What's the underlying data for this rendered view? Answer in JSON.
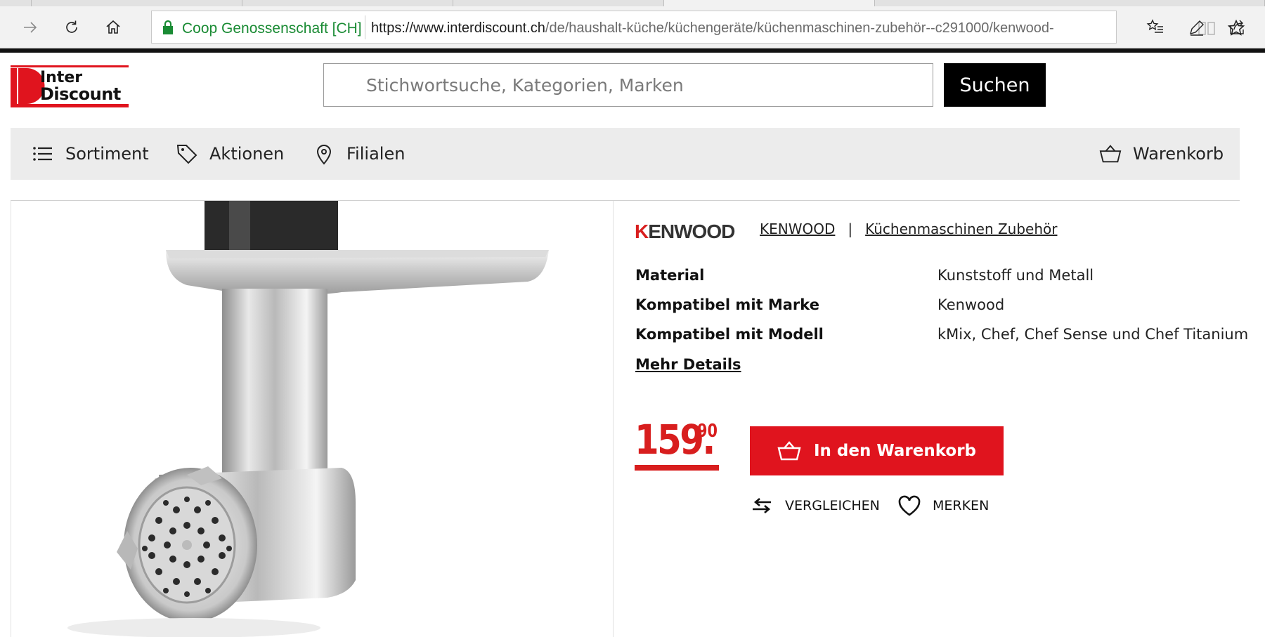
{
  "browser": {
    "site_identity": "Coop Genossenschaft [CH]",
    "url_host": "https://www.interdiscount.ch",
    "url_path": "/de/haushalt-küche/küchengeräte/küchenmaschinen-zubehör--c291000/kenwood-"
  },
  "header": {
    "logo_line1": "Inter",
    "logo_line2": "Discount",
    "search_placeholder": "Stichwortsuche, Kategorien, Marken",
    "search_button": "Suchen"
  },
  "nav": {
    "sortiment": "Sortiment",
    "aktionen": "Aktionen",
    "filialen": "Filialen",
    "warenkorb": "Warenkorb"
  },
  "product": {
    "brand_logo_k": "K",
    "brand_logo_rest": "ENWOOD",
    "brand_link": "KENWOOD",
    "crumb_separator": "|",
    "category_link": "Küchenmaschinen Zubehör",
    "specs": [
      {
        "key": "Material",
        "value": "Kunststoff und Metall"
      },
      {
        "key": "Kompatibel mit Marke",
        "value": "Kenwood"
      },
      {
        "key": "Kompatibel mit Modell",
        "value": "kMix, Chef, Chef Sense und Chef Titanium"
      }
    ],
    "more_details": "Mehr Details",
    "price_main": "159.",
    "price_cents": "90",
    "add_to_cart": "In den Warenkorb",
    "compare": "VERGLEICHEN",
    "remember": "MERKEN"
  },
  "colors": {
    "brand_red": "#e0141e",
    "secure_green": "#1a8b34",
    "nav_bg": "#ececec"
  }
}
